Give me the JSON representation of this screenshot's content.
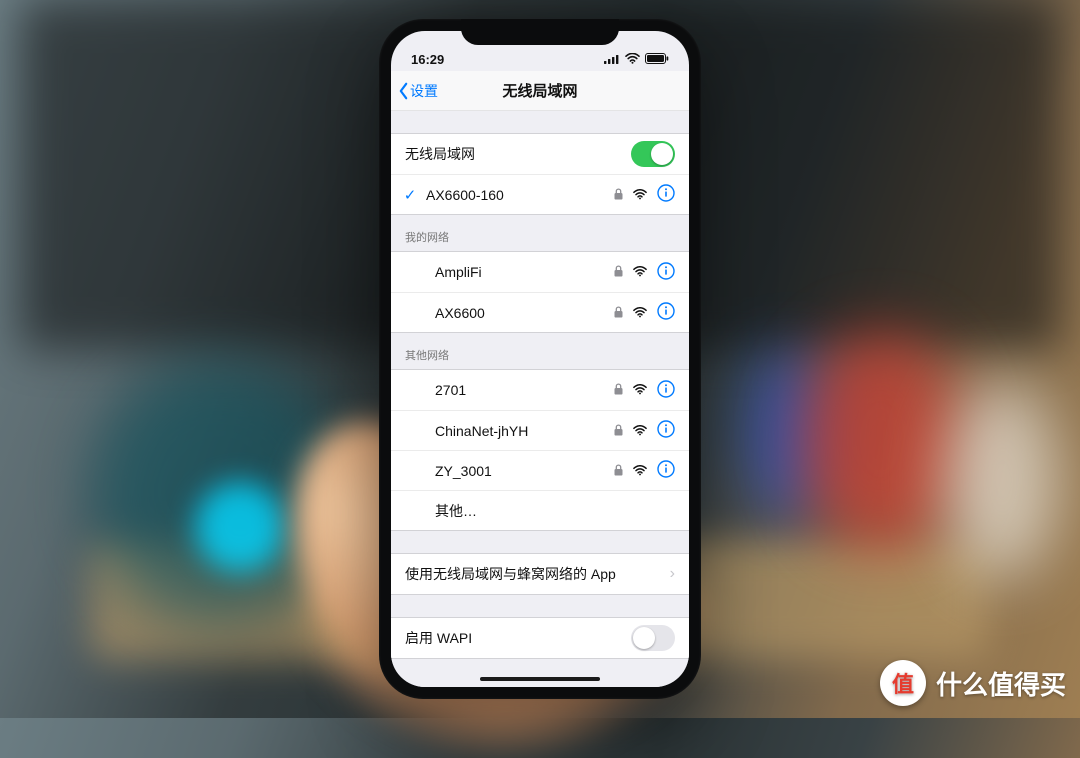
{
  "status": {
    "time": "16:29"
  },
  "nav": {
    "back": "设置",
    "title": "无线局域网"
  },
  "wifi": {
    "toggle_label": "无线局域网",
    "toggle_on": true,
    "connected": {
      "name": "AX6600-160",
      "locked": true
    }
  },
  "sections": {
    "mine_header": "我的网络",
    "mine": [
      {
        "name": "AmpliFi",
        "locked": true
      },
      {
        "name": "AX6600",
        "locked": true
      }
    ],
    "other_header": "其他网络",
    "other": [
      {
        "name": "2701",
        "locked": true
      },
      {
        "name": "ChinaNet-jhYH",
        "locked": true
      },
      {
        "name": "ZY_3001",
        "locked": true
      }
    ],
    "other_manual": "其他…"
  },
  "apps_row": "使用无线局域网与蜂窝网络的 App",
  "wapi": {
    "label": "启用 WAPI",
    "on": false
  },
  "watermark": {
    "text": "什么值得买",
    "badge": "值"
  }
}
